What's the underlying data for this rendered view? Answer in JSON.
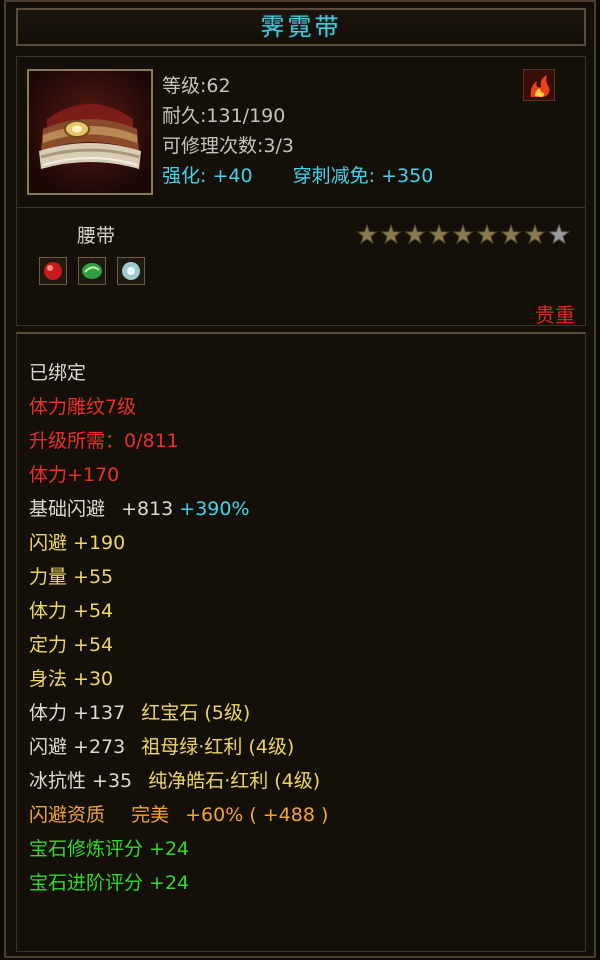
{
  "item": {
    "name": "霁霓带",
    "level": "等级:62",
    "durability": "耐久:131/190",
    "repairs": "可修理次数:3/3",
    "enhance_label": "强化:",
    "enhance_value": "+40",
    "pierce_label": "穿刺减免:",
    "pierce_value": "+350",
    "type": "腰带",
    "quality": "贵重",
    "stars": {
      "filled": 8,
      "total": 9
    }
  },
  "colors": {
    "title": "#4cc9d8",
    "cyan": "#42d4ec",
    "red": "#e8302a",
    "yellow": "#ecd766",
    "orange": "#f0a43a",
    "green": "#33d82c",
    "white": "#dcdad2"
  },
  "gems": [
    {
      "icon": "ruby-gem-icon",
      "color": "#c8191c"
    },
    {
      "icon": "emerald-gem-icon",
      "color": "#2ea043"
    },
    {
      "icon": "pure-stone-gem-icon",
      "color": "#9ec9c8"
    }
  ],
  "attributes": {
    "bound": "已绑定",
    "engrave": "体力雕纹7级",
    "upgrade_need": "升级所需：0/811",
    "stamina_bonus": "体力+170",
    "base_dodge_label": "基础闪避",
    "base_dodge_value": "+813",
    "base_dodge_pct": "+390%",
    "dodge": "闪避  +190",
    "strength": "力量  +55",
    "stamina": "体力  +54",
    "focus": "定力  +54",
    "agility": "身法  +30",
    "gem1_stat": "体力  +137",
    "gem1_name": "红宝石 (5级)",
    "gem2_stat": "闪避  +273",
    "gem2_name": "祖母绿·红利 (4级)",
    "gem3_stat": "冰抗性  +35",
    "gem3_name": "纯净皓石·红利 (4级)",
    "aptitude": "闪避资质",
    "aptitude_grade": "完美",
    "aptitude_value": "+60% ( +488 )",
    "gem_refine_score": "宝石修炼评分  +24",
    "gem_advance_score": "宝石进阶评分  +24"
  }
}
